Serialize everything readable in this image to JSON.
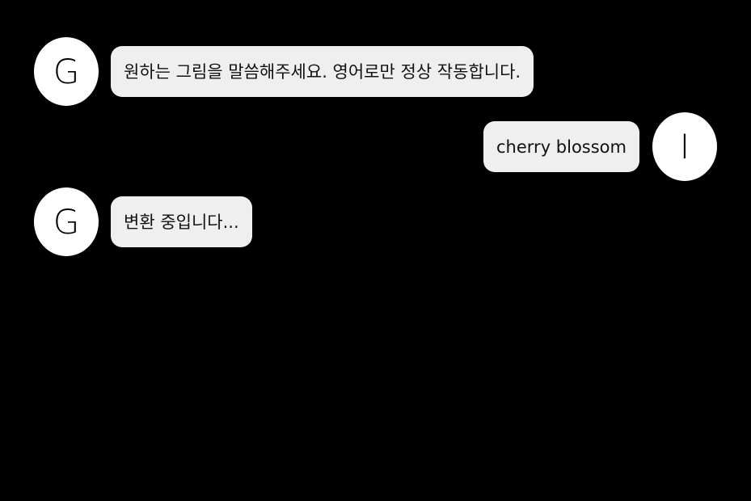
{
  "messages": [
    {
      "sender": "bot",
      "avatar_letter": "G",
      "text": "원하는 그림을 말씀해주세요. 영어로만 정상 작동합니다."
    },
    {
      "sender": "user",
      "avatar_letter": "I",
      "text": "cherry blossom"
    },
    {
      "sender": "bot",
      "avatar_letter": "G",
      "text": "변환 중입니다..."
    }
  ],
  "colors": {
    "background": "#000000",
    "avatar": "#ffffff",
    "bubble": "#efefef",
    "text": "#111111"
  }
}
